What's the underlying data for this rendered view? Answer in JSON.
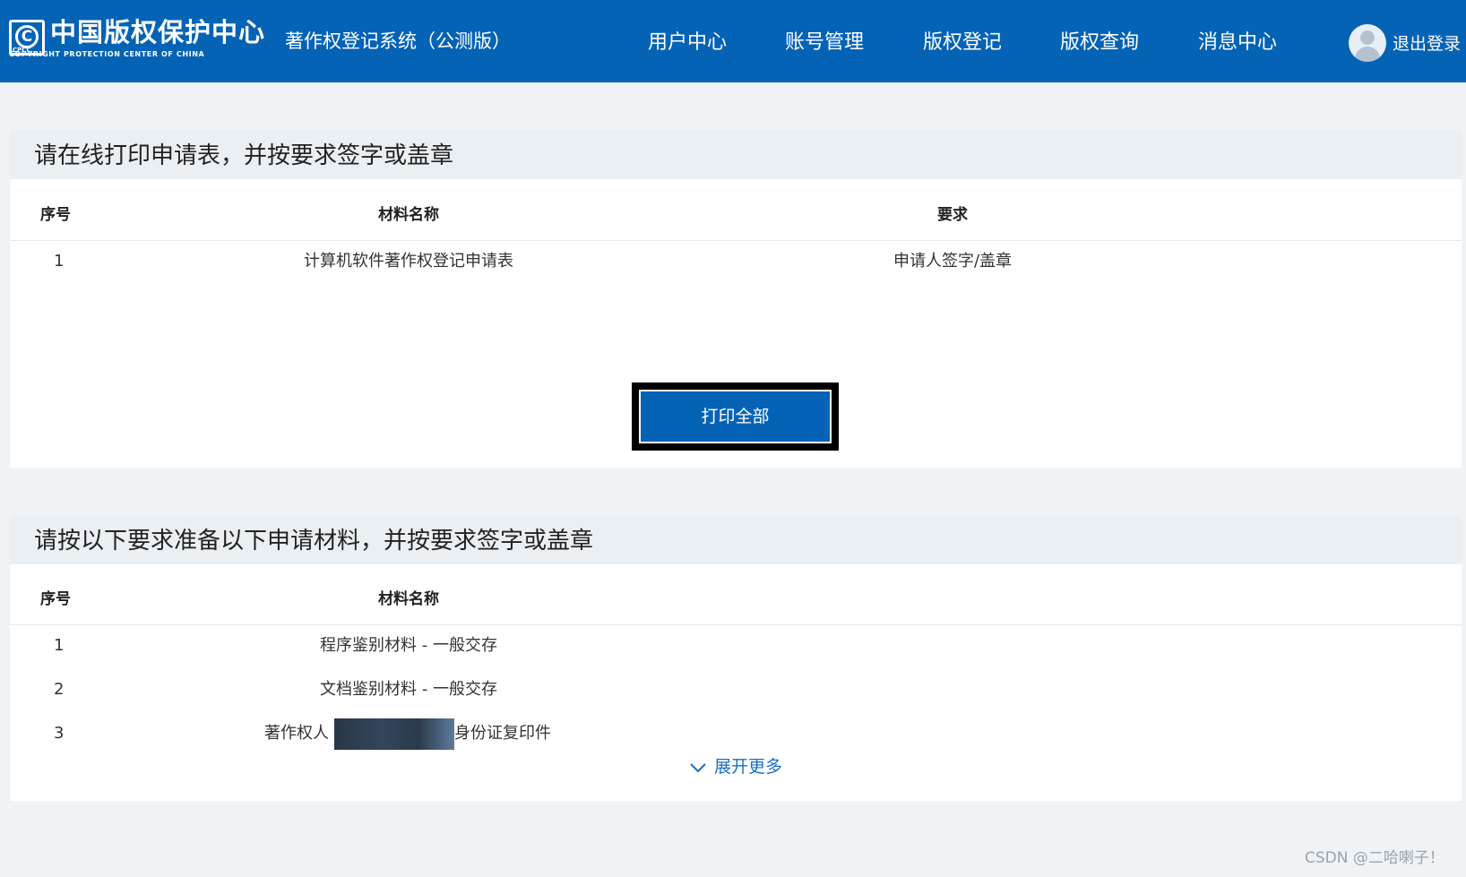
{
  "header": {
    "logo_mark": "C",
    "logo_mark_small": "CPCC",
    "logo_cn": "中国版权保护中心",
    "logo_en": "COPYRIGHT PROTECTION CENTER OF CHINA",
    "system_title": "著作权登记系统（公测版）",
    "nav": [
      "用户中心",
      "账号管理",
      "版权登记",
      "版权查询",
      "消息中心"
    ],
    "logout_label": "退出登录",
    "colors": {
      "bar": "#0563b5",
      "text": "#ffffff"
    }
  },
  "print_section": {
    "title": "请在线打印申请表，并按要求签字或盖章",
    "columns": [
      "序号",
      "材料名称",
      "要求"
    ],
    "rows": [
      {
        "index": "1",
        "name": "计算机软件著作权登记申请表",
        "requirement": "申请人签字/盖章"
      }
    ],
    "print_all_label": "打印全部"
  },
  "materials_section": {
    "title": "请按以下要求准备以下申请材料，并按要求签字或盖章",
    "columns": [
      "序号",
      "材料名称"
    ],
    "rows": [
      {
        "index": "1",
        "name": "程序鉴别材料 - 一般交存"
      },
      {
        "index": "2",
        "name": "文档鉴别材料 - 一般交存"
      },
      {
        "index": "3",
        "name_prefix": "著作权人",
        "name_suffix": "身份证复印件"
      }
    ],
    "expand_label": "展开更多",
    "expand_icon": "chevron-down-icon"
  },
  "watermark": "CSDN @二哈喇子！",
  "icons": {
    "avatar": "user-avatar-icon",
    "logo": "copyright-logo-icon"
  }
}
